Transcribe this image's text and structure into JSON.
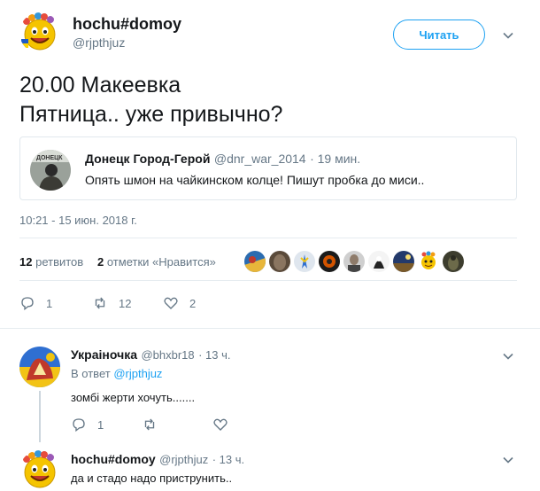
{
  "author": {
    "name": "hochu#domoy",
    "handle": "@rjpthjuz"
  },
  "follow_label": "Читать",
  "tweet": {
    "line1": "20.00 Макеевка",
    "line2": "Пятница.. уже привычно?"
  },
  "quoted": {
    "name": "Донецк Город-Герой",
    "handle": "@dnr_war_2014",
    "time": "· 19 мин.",
    "text": "Опять шмон на чайкинском колце! Пишут пробка до миси..",
    "avatar_label": "ДОНЕЦК"
  },
  "timestamp": "10:21 - 15 июн. 2018 г.",
  "stats": {
    "retweets_count": "12",
    "retweets_label": "ретвитов",
    "likes_count": "2",
    "likes_label": "отметки «Нравится»"
  },
  "actions": {
    "reply_count": "1",
    "retweet_count": "12",
    "like_count": "2"
  },
  "replies": [
    {
      "name": "Украіночка",
      "handle": "@bhxbr18",
      "time": "· 13 ч.",
      "reply_to_prefix": "В ответ",
      "reply_to_handle": "@rjpthjuz",
      "text": "зомбі жерти хочуть.......",
      "reply_count": "1"
    },
    {
      "name": "hochu#domoy",
      "handle": "@rjpthjuz",
      "time": "· 13 ч.",
      "text": "да и стадо надо приструнить.."
    }
  ],
  "colors": {
    "accent": "#1da1f2",
    "muted": "#657786",
    "divider": "#e6ecf0"
  },
  "icons": [
    "smiley-avatar-icon",
    "chevron-down-icon",
    "reply-icon",
    "retweet-icon",
    "heart-icon"
  ]
}
